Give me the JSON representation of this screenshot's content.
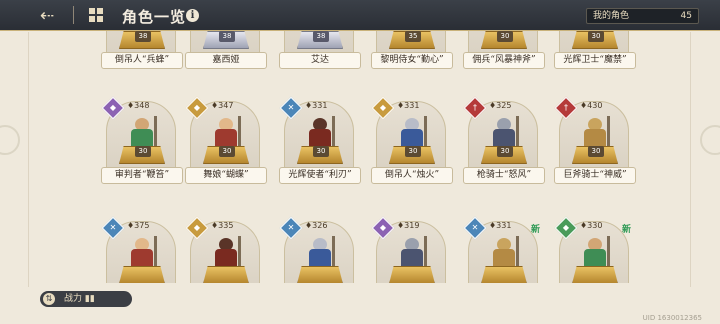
{
  "header": {
    "back_icon": "back-arrow-icon",
    "menu_icon": "grid-icon",
    "title": "角色一览",
    "info_icon": "i",
    "owned_label": "我的角色",
    "owned_count": "45"
  },
  "rows": [
    {
      "cards": [
        {
          "name": "倒吊人“兵蜂”",
          "level": "38",
          "pedestal": "gold"
        },
        {
          "name": "嘉西娅",
          "level": "38",
          "pedestal": "silver"
        },
        {
          "name": "艾达",
          "level": "38",
          "pedestal": "silver"
        },
        {
          "name": "黎明侍女“勤心”",
          "level": "35",
          "pedestal": "gold"
        },
        {
          "name": "佣兵“风暴神斧”",
          "level": "30",
          "pedestal": "gold"
        },
        {
          "name": "光辉卫士“魔禁”",
          "level": "30",
          "pedestal": "gold"
        }
      ]
    },
    {
      "cards": [
        {
          "name": "审判者“鞭笞”",
          "level": "30",
          "power": "348",
          "class_color": "#8c62b3",
          "class_symbol": "◆"
        },
        {
          "name": "舞娘“蝴蝶”",
          "level": "30",
          "power": "347",
          "class_color": "#c89b3e",
          "class_symbol": "◆"
        },
        {
          "name": "光辉使者“利刃”",
          "level": "30",
          "power": "331",
          "class_color": "#4c86b8",
          "class_symbol": "✕"
        },
        {
          "name": "倒吊人“烛火”",
          "level": "30",
          "power": "331",
          "class_color": "#c89b3e",
          "class_symbol": "◆"
        },
        {
          "name": "枪骑士“怒风”",
          "level": "30",
          "power": "325",
          "class_color": "#b53a3a",
          "class_symbol": "†"
        },
        {
          "name": "巨斧骑士“神威”",
          "level": "30",
          "power": "430",
          "class_color": "#b53a3a",
          "class_symbol": "†"
        }
      ]
    },
    {
      "cards": [
        {
          "power": "375",
          "class_color": "#4c86b8",
          "class_symbol": "✕",
          "new": ""
        },
        {
          "power": "335",
          "class_color": "#c89b3e",
          "class_symbol": "◆",
          "new": ""
        },
        {
          "power": "326",
          "class_color": "#4c86b8",
          "class_symbol": "✕",
          "new": ""
        },
        {
          "power": "319",
          "class_color": "#8c62b3",
          "class_symbol": "◆",
          "new": ""
        },
        {
          "power": "331",
          "class_color": "#4c86b8",
          "class_symbol": "✕",
          "new": "新"
        },
        {
          "power": "330",
          "class_color": "#4a9b5a",
          "class_symbol": "◆",
          "new": "新"
        }
      ]
    }
  ],
  "footer": {
    "sort_icon": "sort-icon",
    "label": "战力"
  },
  "uid": "UID 1630012365"
}
